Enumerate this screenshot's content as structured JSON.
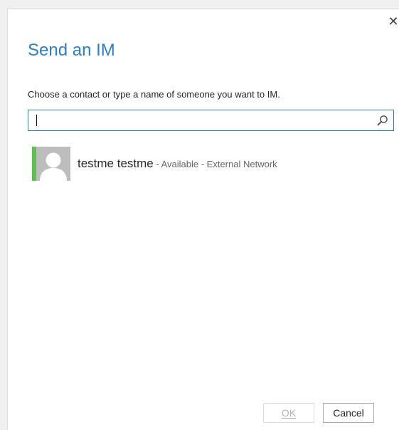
{
  "dialog": {
    "close_glyph": "✕",
    "title": "Send an IM",
    "prompt": "Choose a contact or type a name of someone you want to IM.",
    "search": {
      "value": "",
      "placeholder": "",
      "icon": "search-icon"
    },
    "contacts": [
      {
        "name": "testme testme",
        "status": " - Available - External Network",
        "presence_color": "#5cc14f",
        "avatar_icon": "default-person-icon"
      }
    ],
    "buttons": {
      "ok_label": "OK",
      "cancel_label": "Cancel"
    }
  },
  "colors": {
    "accent": "#2d7ec2",
    "available": "#5cc14f"
  }
}
